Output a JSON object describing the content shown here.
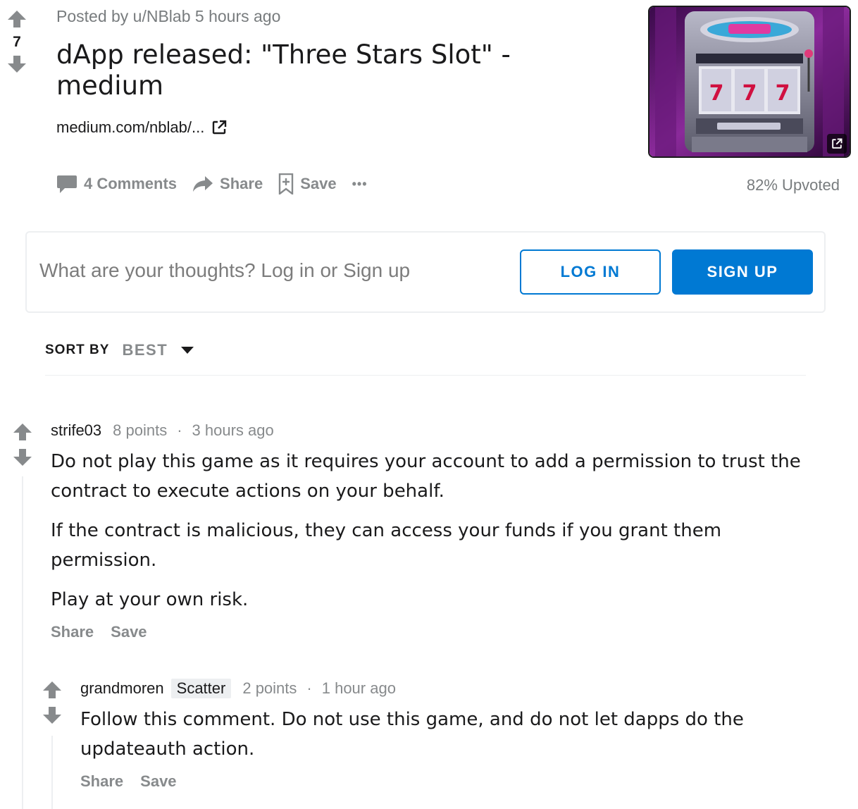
{
  "post": {
    "score": "7",
    "posted_by": "Posted by u/NBlab 5 hours ago",
    "title": "dApp released: \"Three Stars Slot\" - medium",
    "link": "medium.com/nblab/...",
    "comments_label": "4 Comments",
    "share_label": "Share",
    "save_label": "Save",
    "more_label": "•••",
    "upvoted": "82% Upvoted"
  },
  "login_prompt": {
    "text": "What are your thoughts? Log in or Sign up",
    "login_label": "LOG IN",
    "signup_label": "SIGN UP"
  },
  "sort": {
    "label": "SORT BY",
    "value": "BEST"
  },
  "comments": [
    {
      "user": "strife03",
      "points": "8 points",
      "dot": "·",
      "time": "3 hours ago",
      "paragraphs": [
        "Do not play this game as it requires your account to add a permission to trust the contract to execute actions on your behalf.",
        "If the contract is malicious, they can access your funds if you grant them permission.",
        "Play at your own risk."
      ],
      "share_label": "Share",
      "save_label": "Save"
    },
    {
      "user": "grandmoren",
      "flair": "Scatter",
      "points": "2 points",
      "dot": "·",
      "time": "1 hour ago",
      "paragraphs": [
        "Follow this comment. Do not use this game, and do not let dapps do the updateauth action."
      ],
      "share_label": "Share",
      "save_label": "Save"
    }
  ],
  "colors": {
    "accent": "#0079d3",
    "muted": "#878a8c",
    "text": "#1a1a1b"
  }
}
